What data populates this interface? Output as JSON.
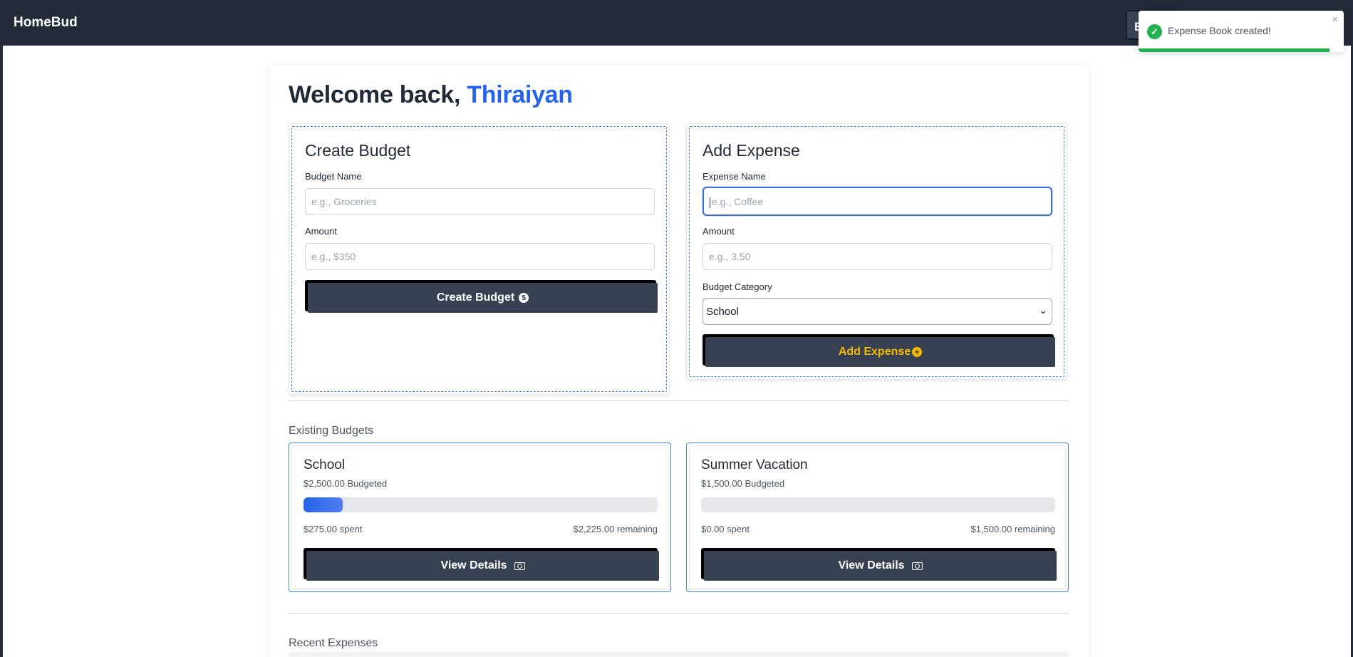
{
  "navbar": {
    "brand": "HomeBud",
    "button_label": "E"
  },
  "welcome": {
    "greeting": "Welcome back,",
    "user": "Thiraiyan"
  },
  "create_budget": {
    "title": "Create Budget",
    "name_label": "Budget Name",
    "name_placeholder": "e.g., Groceries",
    "amount_label": "Amount",
    "amount_placeholder": "e.g., $350",
    "button_label": "Create Budget",
    "button_icon": "dollar-circle-icon"
  },
  "add_expense": {
    "title": "Add Expense",
    "name_label": "Expense Name",
    "name_placeholder": "e.g., Coffee",
    "amount_label": "Amount",
    "amount_placeholder": "e.g., 3.50",
    "category_label": "Budget Category",
    "category_selected": "School",
    "button_label": "Add Expense",
    "button_icon": "plus-circle-icon"
  },
  "existing_budgets": {
    "title": "Existing Budgets",
    "items": [
      {
        "name": "School",
        "budgeted": "$2,500.00 Budgeted",
        "spent": "$275.00 spent",
        "remaining": "$2,225.00 remaining",
        "progress": 0.11,
        "button_label": "View Details"
      },
      {
        "name": "Summer Vacation",
        "budgeted": "$1,500.00 Budgeted",
        "spent": "$0.00 spent",
        "remaining": "$1,500.00 remaining",
        "progress": 0.0,
        "button_label": "View Details"
      }
    ]
  },
  "recent_expenses": {
    "title": "Recent Expenses"
  },
  "toast": {
    "message": "Expense Book created!",
    "close": "×",
    "progress": 0.93,
    "color": "#22b14c"
  },
  "colors": {
    "navbar": "#232b39",
    "accent": "#2563eb",
    "button": "#374151",
    "button_accent": "#f5b800"
  }
}
